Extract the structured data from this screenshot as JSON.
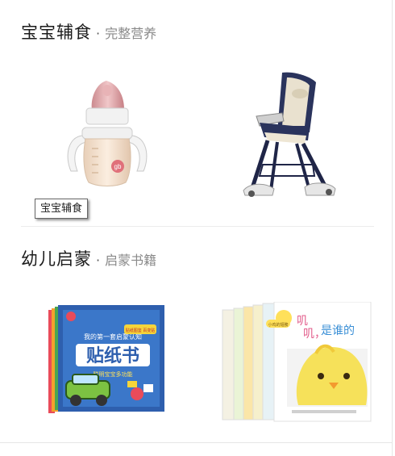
{
  "sections": [
    {
      "title": "宝宝辅食",
      "separator": "·",
      "subtitle": "完整营养"
    },
    {
      "title": "幼儿启蒙",
      "separator": "·",
      "subtitle": "启蒙书籍"
    }
  ],
  "tooltip": {
    "text": "宝宝辅食"
  },
  "products": {
    "bottle": {
      "brand_mark": "gb"
    },
    "sticker_book": {
      "top_line": "我的第一套启蒙认知",
      "title": "贴纸书",
      "subtitle": "聪明宝宝多功能",
      "tag": "贴纸图鉴 百变贴"
    },
    "board_books": {
      "title_line1": "叽",
      "title_line2": "叽，",
      "title_line3": "是谁的",
      "badge": "小鸡的翅膀"
    }
  },
  "colors": {
    "bottle_pink": "#d99a9f",
    "chair_navy": "#26305a",
    "book_blue": "#2e5fae",
    "chick_yellow": "#f6e15a"
  }
}
